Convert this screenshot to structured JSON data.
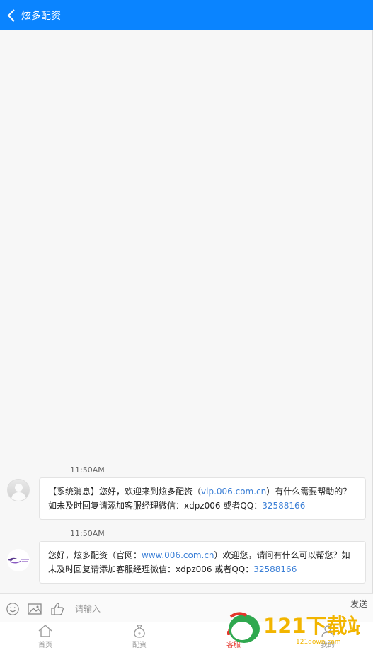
{
  "header": {
    "title": "炫多配资"
  },
  "messages": [
    {
      "time": "11:50AM",
      "avatar": "default-avatar",
      "parts": [
        "【系统消息】您好，欢迎来到炫多配资（",
        "vip.006.com.cn",
        "）有什么需要帮助的？ 如未及时回复请添加客服经理微信：xdpz006 或者QQ：",
        "32588166"
      ]
    },
    {
      "time": "11:50AM",
      "avatar": "brand-logo",
      "parts": [
        "您好，炫多配资（官网：",
        "www.006.com.cn",
        "）欢迎您，请问有什么可以帮您？如未及时回复请添加客服经理微信：xdpz006 或者QQ：",
        "32588166"
      ]
    }
  ],
  "input": {
    "placeholder": "请输入",
    "send_label": "发送"
  },
  "tabs": [
    {
      "label": "首页",
      "icon": "home-icon",
      "active": false
    },
    {
      "label": "配资",
      "icon": "money-bag-icon",
      "active": false
    },
    {
      "label": "客服",
      "icon": "service-icon",
      "active": true
    },
    {
      "label": "我的",
      "icon": "user-icon",
      "active": false
    }
  ],
  "watermark": {
    "text": "121下载站",
    "subtext": "121down.com"
  },
  "colors": {
    "primary": "#0a84ff",
    "active_tab": "#e5352b",
    "link": "#3b7fd6"
  }
}
